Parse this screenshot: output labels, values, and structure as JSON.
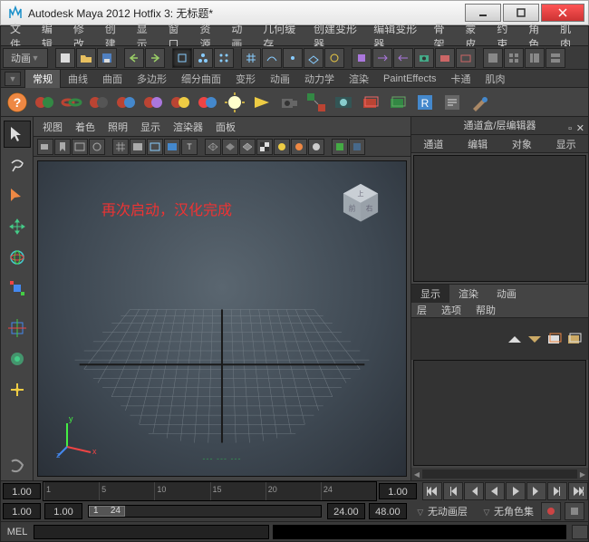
{
  "title": "Autodesk Maya 2012 Hotfix 3: 无标题*",
  "menubar": [
    "文件",
    "编辑",
    "修改",
    "创建",
    "显示",
    "窗口",
    "资源",
    "动画",
    "几何缓存",
    "创建变形器",
    "编辑变形器",
    "骨架",
    "蒙皮",
    "约束",
    "角色",
    "肌肉"
  ],
  "module_selector": "动画",
  "shelf_tabs": [
    "常规",
    "曲线",
    "曲面",
    "多边形",
    "细分曲面",
    "变形",
    "动画",
    "动力学",
    "渲染",
    "PaintEffects",
    "卡通",
    "肌肉"
  ],
  "shelf_active": 0,
  "viewport": {
    "menus": [
      "视图",
      "着色",
      "照明",
      "显示",
      "渲染器",
      "面板"
    ],
    "overlay": "再次启动，汉化完成",
    "stats": "--- --- ---",
    "axes": {
      "x": "x",
      "y": "y",
      "z": "z"
    }
  },
  "right_panel": {
    "title": "通道盒/层编辑器",
    "tabs1": [
      "通道",
      "编辑",
      "对象",
      "显示"
    ],
    "tabs2": [
      "显示",
      "渲染",
      "动画"
    ],
    "tabs2_active": 0,
    "subopts": [
      "层",
      "选项",
      "帮助"
    ]
  },
  "timeline": {
    "start_field": "1.00",
    "ticks": [
      "1",
      "5",
      "10",
      "15",
      "20",
      "24"
    ],
    "end_field": "1.00",
    "range": {
      "a": "1.00",
      "b": "1.00",
      "c": "1",
      "d": "24",
      "e": "24.00",
      "f": "48.00"
    },
    "anim_layer": "无动画层",
    "char_set": "无角色集"
  },
  "cmd": {
    "label": "MEL"
  },
  "colors": {
    "accent_red": "#e33",
    "accent_green": "#4c4",
    "accent_blue": "#48e",
    "accent_yellow": "#ec4",
    "accent_cyan": "#4cc",
    "accent_purple": "#b5e"
  }
}
